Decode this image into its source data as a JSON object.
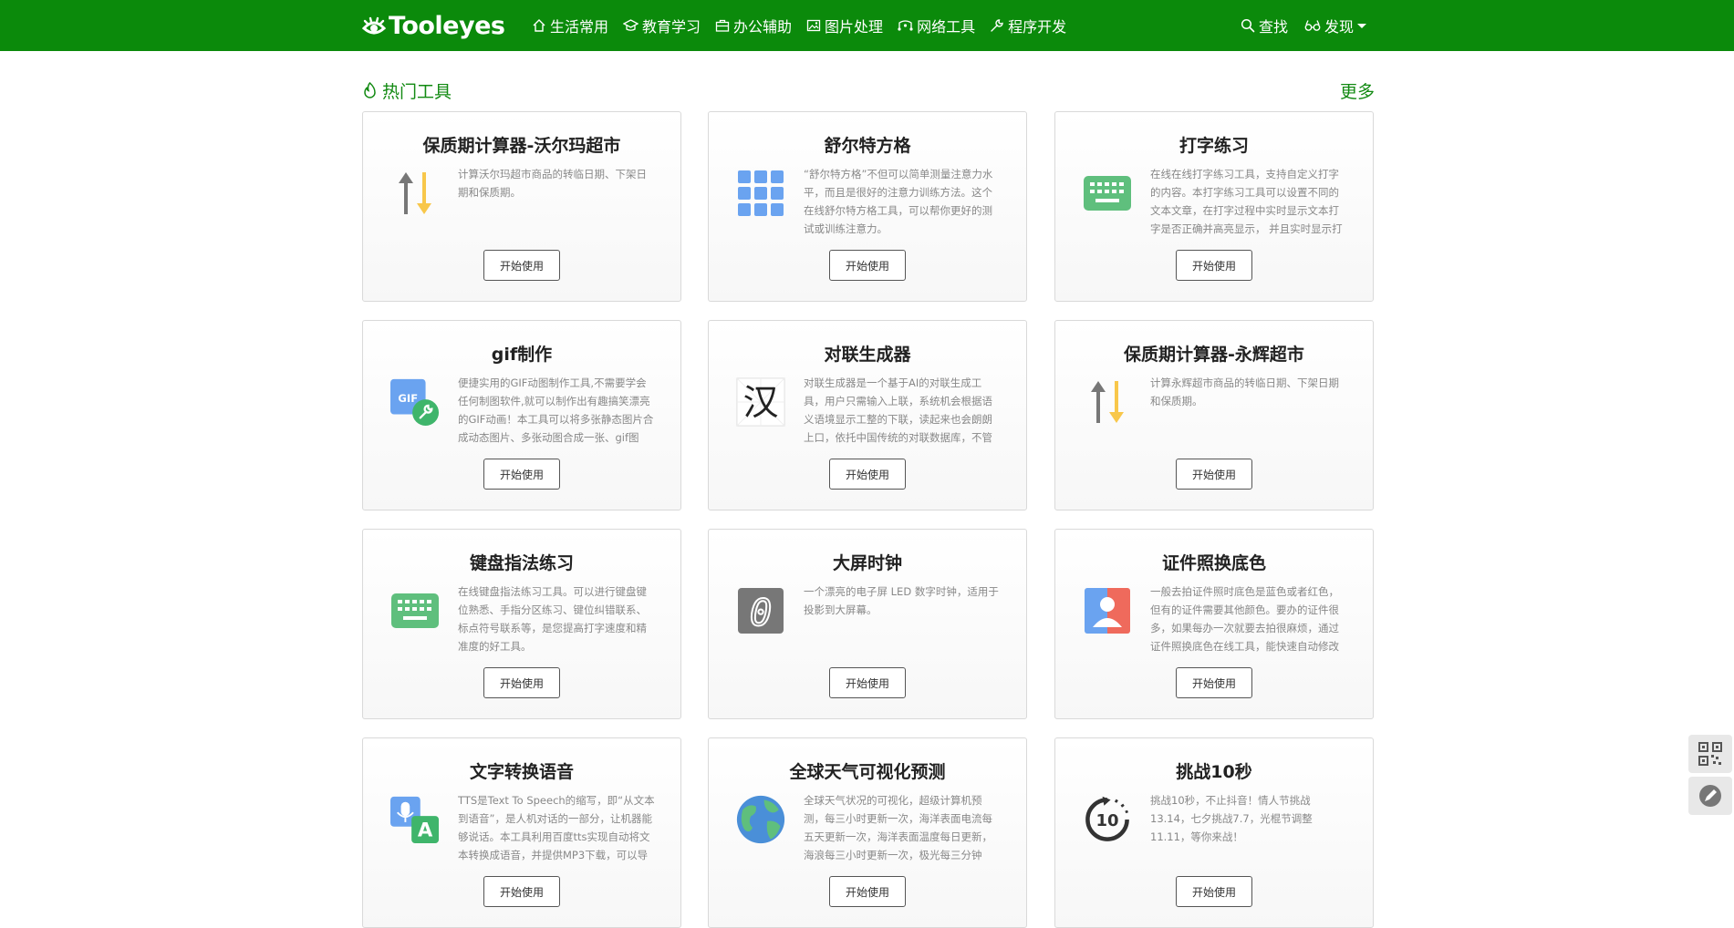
{
  "brand": {
    "name": "Tooleyes"
  },
  "nav": {
    "items": [
      {
        "label": "生活常用"
      },
      {
        "label": "教育学习"
      },
      {
        "label": "办公辅助"
      },
      {
        "label": "图片处理"
      },
      {
        "label": "网络工具"
      },
      {
        "label": "程序开发"
      }
    ],
    "search_label": "查找",
    "discover_label": "发现"
  },
  "section": {
    "title": "热门工具",
    "more": "更多"
  },
  "button_label": "开始使用",
  "cards": [
    {
      "title": "保质期计算器-沃尔玛超市",
      "desc": "计算沃尔玛超市商品的转临日期、下架日期和保质期。",
      "icon": "sort-arrows-icon"
    },
    {
      "title": "舒尔特方格",
      "desc": "“舒尔特方格”不但可以简单测量注意力水平，而且是很好的注意力训练方法。这个在线舒尔特方格工具，可以帮你更好的测试或训练注意力。",
      "icon": "grid-icon"
    },
    {
      "title": "打字练习",
      "desc": "在线在线打字练习工具，支持自定义打字的内容。本打字练习工具可以设置不同的文本文章，在打字过程中实时显示文本打字是否正确并高亮显示， 并且实时显示打",
      "icon": "keyboard-icon"
    },
    {
      "title": "gif制作",
      "desc": "便捷实用的GIF动图制作工具,不需要学会任何制图软件,就可以制作出有趣搞笑漂亮的GIF动画！本工具可以将多张静态图片合成动态图片、多张动图合成一张、gif图",
      "icon": "gif-tool-icon"
    },
    {
      "title": "对联生成器",
      "desc": "对联生成器是一个基于AI的对联生成工具，用户只需输入上联，系统机会根据语义语境显示工整的下联，读起来也会朗朗上口，依托中国传统的对联数据库，不管",
      "icon": "han-character-icon"
    },
    {
      "title": "保质期计算器-永辉超市",
      "desc": "计算永辉超市商品的转临日期、下架日期和保质期。",
      "icon": "sort-arrows-icon"
    },
    {
      "title": "键盘指法练习",
      "desc": "在线键盘指法练习工具。可以进行键盘键位熟悉、手指分区练习、键位纠错联系、标点符号联系等，是您提高打字速度和精准度的好工具。",
      "icon": "keyboard-icon"
    },
    {
      "title": "大屏时钟",
      "desc": "一个漂亮的电子屏 LED 数字时钟，适用于投影到大屏幕。",
      "icon": "led-digit-icon",
      "digit": "0"
    },
    {
      "title": "证件照换底色",
      "desc": "一般去拍证件照时底色是蓝色或者红色，但有的证件需要其他颜色。要办的证件很多，如果每办一次就要去拍很麻烦，通过证件照换底色在线工具，能快速自动修改",
      "icon": "id-photo-icon"
    },
    {
      "title": "文字转换语音",
      "desc": "TTS是Text To Speech的缩写，即“从文本到语音”，是人机对话的一部分，让机器能够说话。本工具利用百度tts实现自动将文本转换成语音，并提供MP3下载，可以导",
      "icon": "text-to-speech-icon",
      "letter": "A"
    },
    {
      "title": "全球天气可视化预测",
      "desc": "全球天气状况的可视化，超级计算机预测，每三小时更新一次，海洋表面电流每五天更新一次，海洋表面温度每日更新，海浪每三小时更新一次，极光每三分钟",
      "icon": "globe-icon"
    },
    {
      "title": "挑战10秒",
      "desc": "挑战10秒，不止抖音！情人节挑战13.14，七夕挑战7.7，光棍节调整11.11，等你来战！",
      "icon": "timer-10-icon",
      "digit": "10"
    }
  ],
  "colors": {
    "nav_bg": "#0b8a0b",
    "accent": "#128a12"
  }
}
